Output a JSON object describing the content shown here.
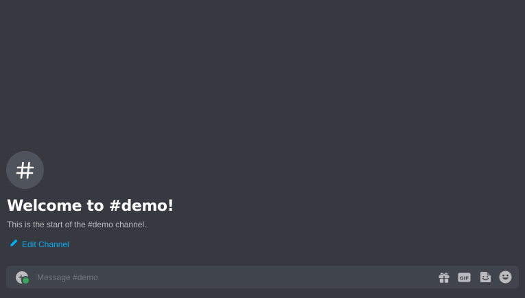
{
  "channel": {
    "welcome_title": "Welcome to #demo!",
    "welcome_subtitle": "This is the start of the #demo channel.",
    "edit_label": "Edit Channel",
    "icon": "hash-icon"
  },
  "composer": {
    "placeholder": "Message #demo",
    "value": "",
    "icons": [
      "attach-plus-icon",
      "gift-icon",
      "gif-icon",
      "sticker-icon",
      "emoji-icon"
    ],
    "gif_label": "GIF"
  },
  "colors": {
    "background": "#36393f",
    "composer_background": "#40444b",
    "link": "#00aff4",
    "icon": "#b9bbbe",
    "status_green": "#3ba55c"
  }
}
